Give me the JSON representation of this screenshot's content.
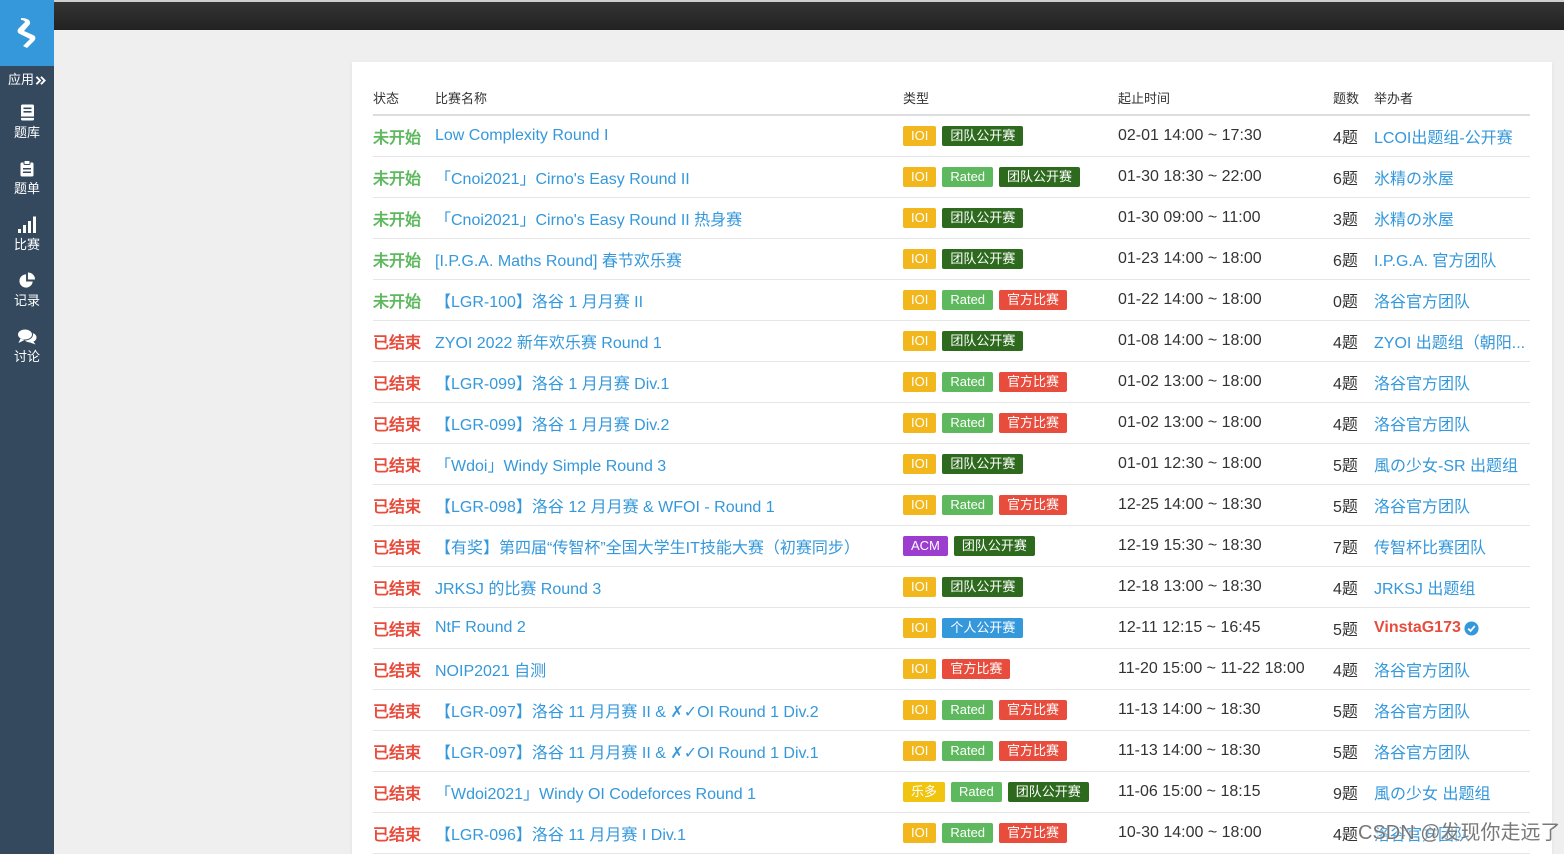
{
  "theme": {
    "page_bg": "#efefef",
    "sidebar_bg": "#34495e",
    "logo_bg": "#3498db",
    "link": "#3498db",
    "text": "#333333"
  },
  "sidebar": {
    "logo_icon": "logo-icon",
    "apps_label": "应用",
    "apps_icon": "double-chevron-right-icon",
    "items": [
      {
        "label": "题库",
        "icon": "book-icon"
      },
      {
        "label": "题单",
        "icon": "clipboard-list-icon"
      },
      {
        "label": "比赛",
        "icon": "signal-bars-icon"
      },
      {
        "label": "记录",
        "icon": "pie-chart-icon"
      },
      {
        "label": "讨论",
        "icon": "comments-icon"
      }
    ]
  },
  "status_colors": {
    "未开始": "#5eb95e",
    "已结束": "#e74c3c"
  },
  "tag_colors": {
    "IOI": "#f2b71c",
    "乐多": "#f1c40f",
    "Rated": "#5eb95e",
    "团队公开赛": "#2d6a1e",
    "官方比赛": "#e74c3c",
    "个人公开赛": "#3498db",
    "ACM": "#9d3dcf"
  },
  "table": {
    "headers": {
      "status": "状态",
      "name": "比赛名称",
      "type": "类型",
      "time": "起止时间",
      "count": "题数",
      "host": "举办者"
    },
    "rows": [
      {
        "status": "未开始",
        "name": "Low Complexity Round I",
        "tags": [
          "IOI",
          "团队公开赛"
        ],
        "time": "02-01 14:00 ~ 17:30",
        "count": "4题",
        "host": "LCOI出题组-公开赛"
      },
      {
        "status": "未开始",
        "name": "「Cnoi2021」Cirno's Easy Round II",
        "tags": [
          "IOI",
          "Rated",
          "团队公开赛"
        ],
        "time": "01-30 18:30 ~ 22:00",
        "count": "6题",
        "host": "氷精の氷屋"
      },
      {
        "status": "未开始",
        "name": "「Cnoi2021」Cirno's Easy Round II 热身赛",
        "tags": [
          "IOI",
          "团队公开赛"
        ],
        "time": "01-30 09:00 ~ 11:00",
        "count": "3题",
        "host": "氷精の氷屋"
      },
      {
        "status": "未开始",
        "name": "[I.P.G.A. Maths Round] 春节欢乐赛",
        "tags": [
          "IOI",
          "团队公开赛"
        ],
        "time": "01-23 14:00 ~ 18:00",
        "count": "6题",
        "host": "I.P.G.A. 官方团队"
      },
      {
        "status": "未开始",
        "name": "【LGR-100】洛谷 1 月月赛 II",
        "tags": [
          "IOI",
          "Rated",
          "官方比赛"
        ],
        "time": "01-22 14:00 ~ 18:00",
        "count": "0题",
        "host": "洛谷官方团队"
      },
      {
        "status": "已结束",
        "name": "ZYOI 2022 新年欢乐赛 Round 1",
        "tags": [
          "IOI",
          "团队公开赛"
        ],
        "time": "01-08 14:00 ~ 18:00",
        "count": "4题",
        "host": "ZYOI 出题组（朝阳..."
      },
      {
        "status": "已结束",
        "name": "【LGR-099】洛谷 1 月月赛 Div.1",
        "tags": [
          "IOI",
          "Rated",
          "官方比赛"
        ],
        "time": "01-02 13:00 ~ 18:00",
        "count": "4题",
        "host": "洛谷官方团队"
      },
      {
        "status": "已结束",
        "name": "【LGR-099】洛谷 1 月月赛 Div.2",
        "tags": [
          "IOI",
          "Rated",
          "官方比赛"
        ],
        "time": "01-02 13:00 ~ 18:00",
        "count": "4题",
        "host": "洛谷官方团队"
      },
      {
        "status": "已结束",
        "name": "「Wdoi」Windy Simple Round 3",
        "tags": [
          "IOI",
          "团队公开赛"
        ],
        "time": "01-01 12:30 ~ 18:00",
        "count": "5题",
        "host": "風の少女-SR 出题组"
      },
      {
        "status": "已结束",
        "name": "【LGR-098】洛谷 12 月月赛 & WFOI - Round 1",
        "tags": [
          "IOI",
          "Rated",
          "官方比赛"
        ],
        "time": "12-25 14:00 ~ 18:30",
        "count": "5题",
        "host": "洛谷官方团队"
      },
      {
        "status": "已结束",
        "name": "【有奖】第四届“传智杯”全国大学生IT技能大赛（初赛同步）",
        "tags": [
          "ACM",
          "团队公开赛"
        ],
        "time": "12-19 15:30 ~ 18:30",
        "count": "7题",
        "host": "传智杯比赛团队"
      },
      {
        "status": "已结束",
        "name": "JRKSJ 的比赛 Round 3",
        "tags": [
          "IOI",
          "团队公开赛"
        ],
        "time": "12-18 13:00 ~ 18:30",
        "count": "4题",
        "host": "JRKSJ 出题组"
      },
      {
        "status": "已结束",
        "name": "NtF Round 2",
        "tags": [
          "IOI",
          "个人公开赛"
        ],
        "time": "12-11 12:15 ~ 16:45",
        "count": "5题",
        "host": "VinstaG173",
        "host_color": "#e74c3c",
        "host_verified": true
      },
      {
        "status": "已结束",
        "name": "NOIP2021 自测",
        "tags": [
          "IOI",
          "官方比赛"
        ],
        "time": "11-20 15:00 ~ 11-22 18:00",
        "count": "4题",
        "host": "洛谷官方团队"
      },
      {
        "status": "已结束",
        "name": "【LGR-097】洛谷 11 月月赛 II & ✗✓OI Round 1 Div.2",
        "tags": [
          "IOI",
          "Rated",
          "官方比赛"
        ],
        "time": "11-13 14:00 ~ 18:30",
        "count": "5题",
        "host": "洛谷官方团队"
      },
      {
        "status": "已结束",
        "name": "【LGR-097】洛谷 11 月月赛 II & ✗✓OI Round 1 Div.1",
        "tags": [
          "IOI",
          "Rated",
          "官方比赛"
        ],
        "time": "11-13 14:00 ~ 18:30",
        "count": "5题",
        "host": "洛谷官方团队"
      },
      {
        "status": "已结束",
        "name": "「Wdoi2021」Windy OI Codeforces Round 1",
        "tags": [
          "乐多",
          "Rated",
          "团队公开赛"
        ],
        "time": "11-06 15:00 ~ 18:15",
        "count": "9题",
        "host": "風の少女 出题组"
      },
      {
        "status": "已结束",
        "name": "【LGR-096】洛谷 11 月月赛 I Div.1",
        "tags": [
          "IOI",
          "Rated",
          "官方比赛"
        ],
        "time": "10-30 14:00 ~ 18:00",
        "count": "4题",
        "host": "洛谷官方团队"
      }
    ]
  },
  "watermark": "CSDN @发现你走远了"
}
